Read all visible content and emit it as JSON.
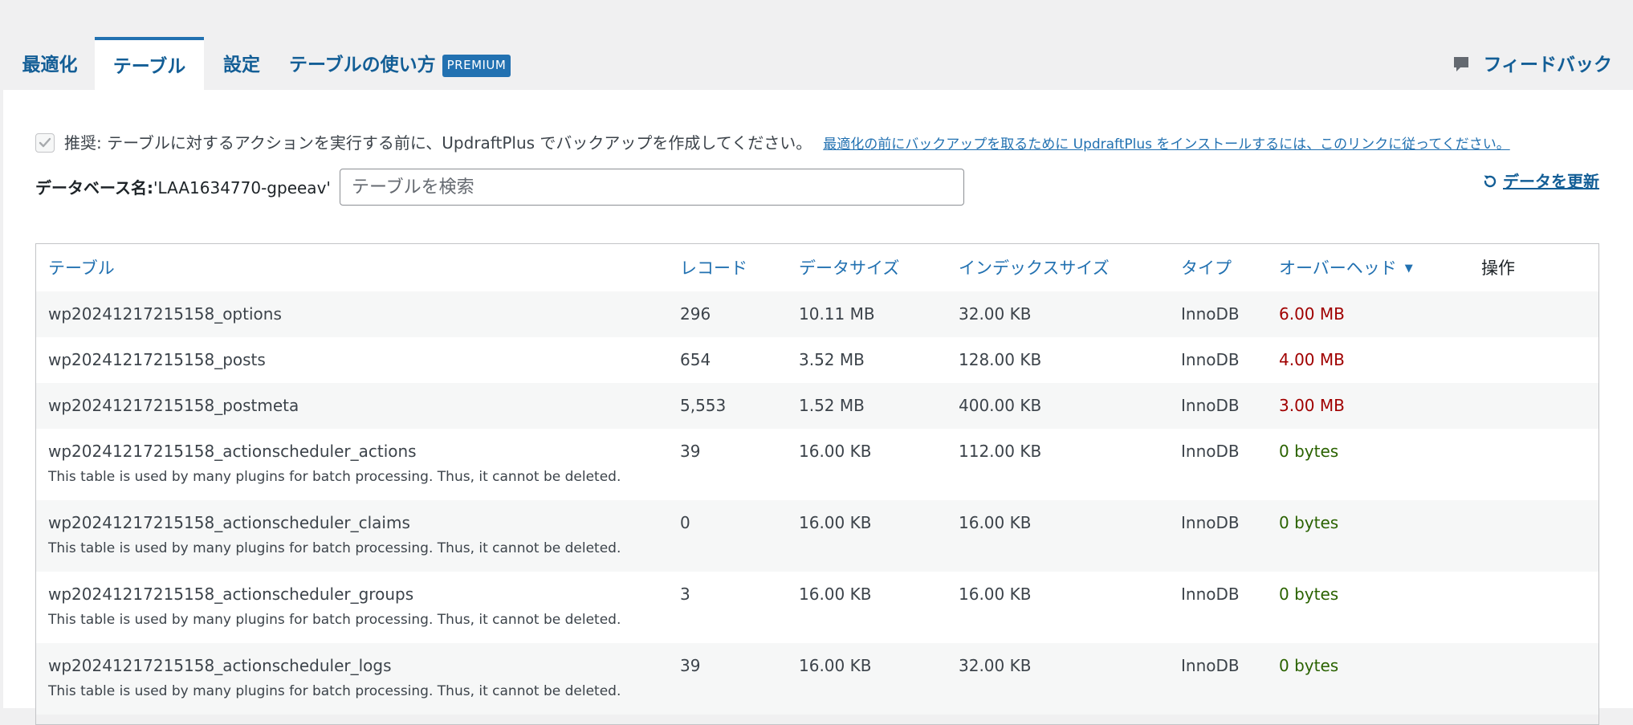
{
  "tabs": [
    {
      "label": "最適化",
      "active": false
    },
    {
      "label": "テーブル",
      "active": true
    },
    {
      "label": "設定",
      "active": false
    },
    {
      "label": "テーブルの使い方",
      "active": false,
      "badge": "PREMIUM"
    }
  ],
  "feedback": {
    "label": "フィードバック",
    "icon": "speech-bubble-icon"
  },
  "notice": {
    "text": "推奨: テーブルに対するアクションを実行する前に、UpdraftPlus でバックアップを作成してください。",
    "link": "最適化の前にバックアップを取るために UpdraftPlus をインストールするには、このリンクに従ってください。",
    "checked": true
  },
  "database": {
    "label": "データベース名:",
    "name": " 'LAA1634770-gpeeav'"
  },
  "search": {
    "placeholder": "テーブルを検索",
    "value": ""
  },
  "refresh": {
    "label": "データを更新",
    "icon": "refresh-icon"
  },
  "table": {
    "columns": {
      "name": "テーブル",
      "records": "レコード",
      "data_size": "データサイズ",
      "index_size": "インデックスサイズ",
      "type": "タイプ",
      "overhead": "オーバーヘッド",
      "action": "操作"
    },
    "sort_indicator": "▼",
    "rows": [
      {
        "name": "wp20241217215158_options",
        "records": "296",
        "data_size": "10.11 MB",
        "index_size": "32.00 KB",
        "type": "InnoDB",
        "overhead": "6.00 MB",
        "note": ""
      },
      {
        "name": "wp20241217215158_posts",
        "records": "654",
        "data_size": "3.52 MB",
        "index_size": "128.00 KB",
        "type": "InnoDB",
        "overhead": "4.00 MB",
        "note": ""
      },
      {
        "name": "wp20241217215158_postmeta",
        "records": "5,553",
        "data_size": "1.52 MB",
        "index_size": "400.00 KB",
        "type": "InnoDB",
        "overhead": "3.00 MB",
        "note": ""
      },
      {
        "name": "wp20241217215158_actionscheduler_actions",
        "records": "39",
        "data_size": "16.00 KB",
        "index_size": "112.00 KB",
        "type": "InnoDB",
        "overhead": "0 bytes",
        "note": "This table is used by many plugins for batch processing. Thus, it cannot be deleted."
      },
      {
        "name": "wp20241217215158_actionscheduler_claims",
        "records": "0",
        "data_size": "16.00 KB",
        "index_size": "16.00 KB",
        "type": "InnoDB",
        "overhead": "0 bytes",
        "note": "This table is used by many plugins for batch processing. Thus, it cannot be deleted."
      },
      {
        "name": "wp20241217215158_actionscheduler_groups",
        "records": "3",
        "data_size": "16.00 KB",
        "index_size": "16.00 KB",
        "type": "InnoDB",
        "overhead": "0 bytes",
        "note": "This table is used by many plugins for batch processing. Thus, it cannot be deleted."
      },
      {
        "name": "wp20241217215158_actionscheduler_logs",
        "records": "39",
        "data_size": "16.00 KB",
        "index_size": "32.00 KB",
        "type": "InnoDB",
        "overhead": "0 bytes",
        "note": "This table is used by many plugins for batch processing. Thus, it cannot be deleted."
      }
    ]
  },
  "colors": {
    "accent": "#2271b1",
    "overhead_high": "#a00000",
    "overhead_zero": "#2a6200"
  }
}
